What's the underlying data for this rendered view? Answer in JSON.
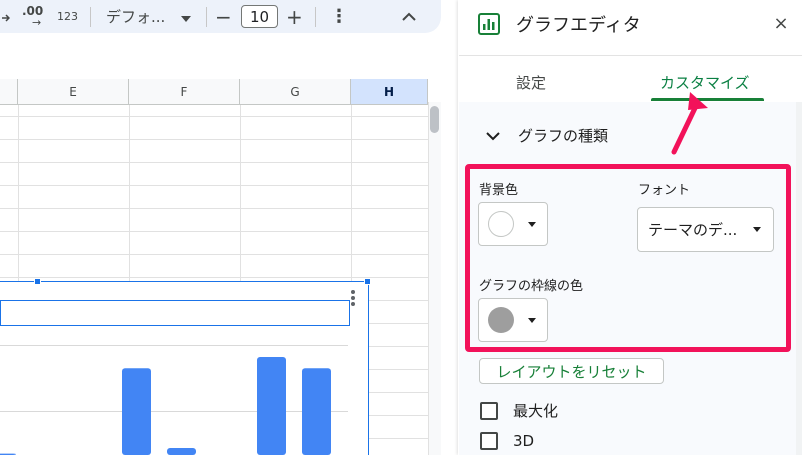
{
  "toolbar": {
    "decimal_label": ".00",
    "decimal_arrow": "→",
    "number_format_label": "123",
    "font_name": "デフォ...",
    "minus_label": "−",
    "font_size": "10",
    "plus_label": "+",
    "more_label": "⋮",
    "collapse_label": "^"
  },
  "sheet": {
    "columns": [
      {
        "label": "E",
        "selected": false
      },
      {
        "label": "F",
        "selected": false
      },
      {
        "label": "G",
        "selected": false
      },
      {
        "label": "H",
        "selected": true
      }
    ]
  },
  "chart": {
    "bar_color": "#4285f4",
    "values": [
      1,
      0,
      0,
      62,
      5,
      0,
      70,
      62
    ]
  },
  "panel": {
    "title": "グラフエディタ",
    "close_label": "×",
    "tabs": [
      {
        "label": "設定",
        "active": false
      },
      {
        "label": "カスタマイズ",
        "active": true
      }
    ],
    "section_title": "グラフの種類",
    "background_label": "背景色",
    "background_color": "#ffffff",
    "font_label": "フォント",
    "font_value": "テーマのデ...",
    "border_label": "グラフの枠線の色",
    "border_color": "#9e9e9e",
    "reset_label": "レイアウトをリセット",
    "checkboxes": [
      {
        "label": "最大化",
        "checked": false
      },
      {
        "label": "3D",
        "checked": false
      }
    ],
    "highlight_color": "#f2125a"
  }
}
